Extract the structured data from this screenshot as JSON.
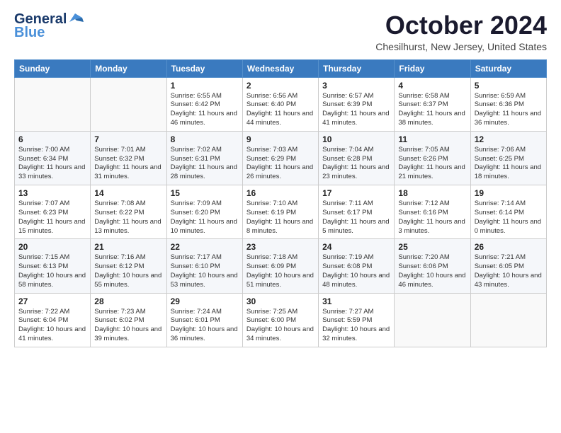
{
  "header": {
    "logo_line1": "General",
    "logo_line2": "Blue",
    "month": "October 2024",
    "location": "Chesilhurst, New Jersey, United States"
  },
  "weekdays": [
    "Sunday",
    "Monday",
    "Tuesday",
    "Wednesday",
    "Thursday",
    "Friday",
    "Saturday"
  ],
  "weeks": [
    [
      {
        "day": "",
        "info": ""
      },
      {
        "day": "",
        "info": ""
      },
      {
        "day": "1",
        "info": "Sunrise: 6:55 AM\nSunset: 6:42 PM\nDaylight: 11 hours and 46 minutes."
      },
      {
        "day": "2",
        "info": "Sunrise: 6:56 AM\nSunset: 6:40 PM\nDaylight: 11 hours and 44 minutes."
      },
      {
        "day": "3",
        "info": "Sunrise: 6:57 AM\nSunset: 6:39 PM\nDaylight: 11 hours and 41 minutes."
      },
      {
        "day": "4",
        "info": "Sunrise: 6:58 AM\nSunset: 6:37 PM\nDaylight: 11 hours and 38 minutes."
      },
      {
        "day": "5",
        "info": "Sunrise: 6:59 AM\nSunset: 6:36 PM\nDaylight: 11 hours and 36 minutes."
      }
    ],
    [
      {
        "day": "6",
        "info": "Sunrise: 7:00 AM\nSunset: 6:34 PM\nDaylight: 11 hours and 33 minutes."
      },
      {
        "day": "7",
        "info": "Sunrise: 7:01 AM\nSunset: 6:32 PM\nDaylight: 11 hours and 31 minutes."
      },
      {
        "day": "8",
        "info": "Sunrise: 7:02 AM\nSunset: 6:31 PM\nDaylight: 11 hours and 28 minutes."
      },
      {
        "day": "9",
        "info": "Sunrise: 7:03 AM\nSunset: 6:29 PM\nDaylight: 11 hours and 26 minutes."
      },
      {
        "day": "10",
        "info": "Sunrise: 7:04 AM\nSunset: 6:28 PM\nDaylight: 11 hours and 23 minutes."
      },
      {
        "day": "11",
        "info": "Sunrise: 7:05 AM\nSunset: 6:26 PM\nDaylight: 11 hours and 21 minutes."
      },
      {
        "day": "12",
        "info": "Sunrise: 7:06 AM\nSunset: 6:25 PM\nDaylight: 11 hours and 18 minutes."
      }
    ],
    [
      {
        "day": "13",
        "info": "Sunrise: 7:07 AM\nSunset: 6:23 PM\nDaylight: 11 hours and 15 minutes."
      },
      {
        "day": "14",
        "info": "Sunrise: 7:08 AM\nSunset: 6:22 PM\nDaylight: 11 hours and 13 minutes."
      },
      {
        "day": "15",
        "info": "Sunrise: 7:09 AM\nSunset: 6:20 PM\nDaylight: 11 hours and 10 minutes."
      },
      {
        "day": "16",
        "info": "Sunrise: 7:10 AM\nSunset: 6:19 PM\nDaylight: 11 hours and 8 minutes."
      },
      {
        "day": "17",
        "info": "Sunrise: 7:11 AM\nSunset: 6:17 PM\nDaylight: 11 hours and 5 minutes."
      },
      {
        "day": "18",
        "info": "Sunrise: 7:12 AM\nSunset: 6:16 PM\nDaylight: 11 hours and 3 minutes."
      },
      {
        "day": "19",
        "info": "Sunrise: 7:14 AM\nSunset: 6:14 PM\nDaylight: 11 hours and 0 minutes."
      }
    ],
    [
      {
        "day": "20",
        "info": "Sunrise: 7:15 AM\nSunset: 6:13 PM\nDaylight: 10 hours and 58 minutes."
      },
      {
        "day": "21",
        "info": "Sunrise: 7:16 AM\nSunset: 6:12 PM\nDaylight: 10 hours and 55 minutes."
      },
      {
        "day": "22",
        "info": "Sunrise: 7:17 AM\nSunset: 6:10 PM\nDaylight: 10 hours and 53 minutes."
      },
      {
        "day": "23",
        "info": "Sunrise: 7:18 AM\nSunset: 6:09 PM\nDaylight: 10 hours and 51 minutes."
      },
      {
        "day": "24",
        "info": "Sunrise: 7:19 AM\nSunset: 6:08 PM\nDaylight: 10 hours and 48 minutes."
      },
      {
        "day": "25",
        "info": "Sunrise: 7:20 AM\nSunset: 6:06 PM\nDaylight: 10 hours and 46 minutes."
      },
      {
        "day": "26",
        "info": "Sunrise: 7:21 AM\nSunset: 6:05 PM\nDaylight: 10 hours and 43 minutes."
      }
    ],
    [
      {
        "day": "27",
        "info": "Sunrise: 7:22 AM\nSunset: 6:04 PM\nDaylight: 10 hours and 41 minutes."
      },
      {
        "day": "28",
        "info": "Sunrise: 7:23 AM\nSunset: 6:02 PM\nDaylight: 10 hours and 39 minutes."
      },
      {
        "day": "29",
        "info": "Sunrise: 7:24 AM\nSunset: 6:01 PM\nDaylight: 10 hours and 36 minutes."
      },
      {
        "day": "30",
        "info": "Sunrise: 7:25 AM\nSunset: 6:00 PM\nDaylight: 10 hours and 34 minutes."
      },
      {
        "day": "31",
        "info": "Sunrise: 7:27 AM\nSunset: 5:59 PM\nDaylight: 10 hours and 32 minutes."
      },
      {
        "day": "",
        "info": ""
      },
      {
        "day": "",
        "info": ""
      }
    ]
  ]
}
